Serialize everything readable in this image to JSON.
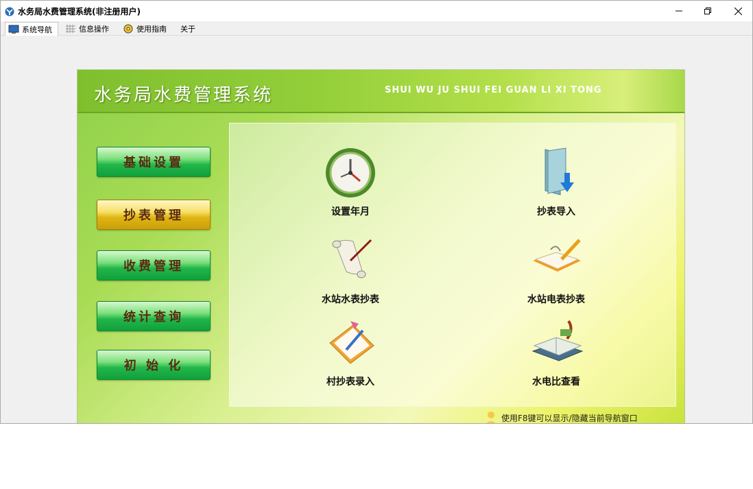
{
  "window": {
    "title": "水务局水费管理系统(非注册用户)"
  },
  "tabs": [
    {
      "label": "系统导航",
      "icon": "monitor-icon"
    },
    {
      "label": "信息操作",
      "icon": "grid-icon"
    },
    {
      "label": "使用指南",
      "icon": "help-disc-icon"
    },
    {
      "label": "关于",
      "icon": ""
    }
  ],
  "panel": {
    "title": "水务局水费管理系统",
    "subtitle": "SHUI WU JU SHUI FEI GUAN LI XI TONG",
    "hint": "使用F8键可以显示/隐藏当前导航窗口"
  },
  "menu": [
    {
      "label": "基础设置"
    },
    {
      "label": "抄表管理"
    },
    {
      "label": "收费管理"
    },
    {
      "label": "统计查询"
    },
    {
      "label": "初 始 化"
    }
  ],
  "items": [
    {
      "label": "设置年月",
      "icon": "clock-icon"
    },
    {
      "label": "抄表导入",
      "icon": "folder-import-icon"
    },
    {
      "label": "水站水表抄表",
      "icon": "scroll-quill-icon"
    },
    {
      "label": "水站电表抄表",
      "icon": "notebook-pencil-icon"
    },
    {
      "label": "村抄表录入",
      "icon": "clipboard-pen-icon"
    },
    {
      "label": "水电比查看",
      "icon": "book-stack-icon"
    }
  ],
  "colors": {
    "accent_green": "#22b64a",
    "active_gold": "#e0b412",
    "menu_text": "#5a2a12"
  }
}
